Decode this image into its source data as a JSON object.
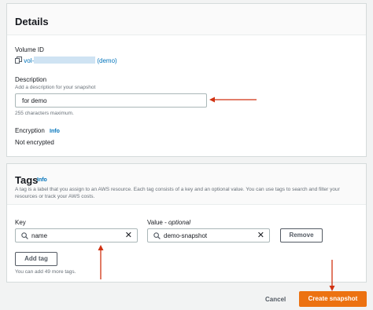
{
  "details": {
    "title": "Details",
    "volume_id_label": "Volume ID",
    "volume_id_prefix": "vol-",
    "volume_id_suffix": "(demo)",
    "description_label": "Description",
    "description_hint": "Add a description for your snapshot",
    "description_value": "for demo",
    "description_constraint": "255 characters maximum.",
    "encryption_label": "Encryption",
    "encryption_info": "Info",
    "encryption_value": "Not encrypted"
  },
  "tags": {
    "title": "Tags",
    "info": "Info",
    "description": "A tag is a label that you assign to an AWS resource. Each tag consists of a key and an optional value. You can use tags to search and filter your resources or track your AWS costs.",
    "key_label": "Key",
    "value_label": "Value - ",
    "value_label_optional": "optional",
    "key_value": "name",
    "value_value": "demo-snapshot",
    "remove_label": "Remove",
    "add_tag_label": "Add tag",
    "remaining": "You can add 49 more tags."
  },
  "footer": {
    "cancel_label": "Cancel",
    "create_label": "Create snapshot"
  },
  "colors": {
    "primary": "#ec7211",
    "link": "#0073bb",
    "annotation_arrow": "#d13212"
  }
}
